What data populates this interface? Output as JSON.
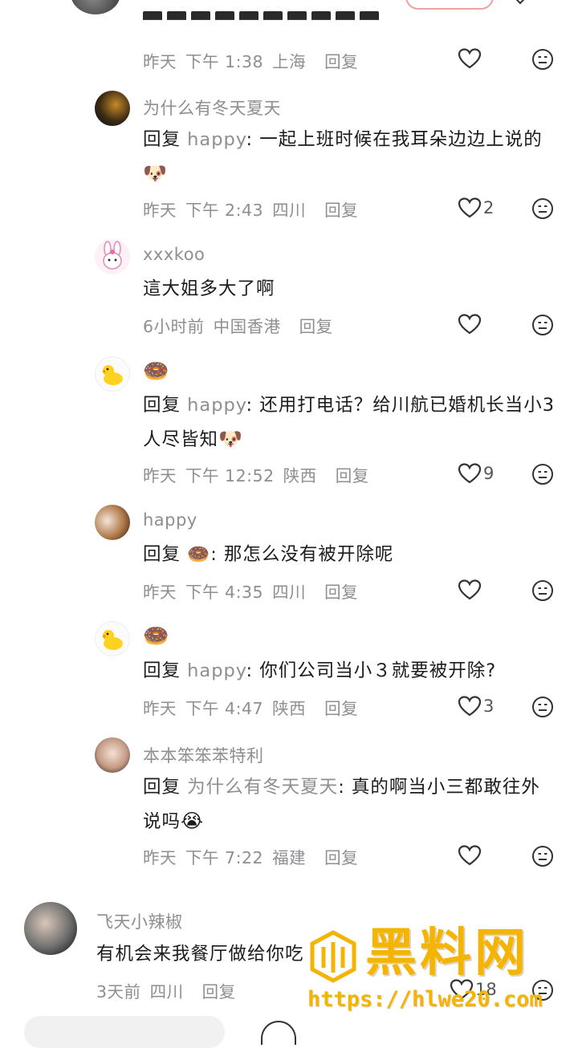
{
  "comments": [
    {
      "id": "c0",
      "meta": {
        "day": "昨天",
        "time": "下午 1:38",
        "location": "上海",
        "reply": "回复"
      },
      "likes": ""
    },
    {
      "id": "c1",
      "username": "为什么有冬天夏天",
      "reply_prefix": "回复",
      "mention": "happy",
      "text": ": 一起上班时候在我耳朵边边上说的",
      "emoji": "🐶",
      "meta": {
        "day": "昨天",
        "time": "下午 2:43",
        "location": "四川",
        "reply": "回复"
      },
      "likes": "2"
    },
    {
      "id": "c2",
      "username": "xxxkoo",
      "text": "這大姐多大了啊",
      "meta": {
        "day": "6小时前",
        "time": "",
        "location": "中国香港",
        "reply": "回复"
      },
      "likes": ""
    },
    {
      "id": "c3",
      "username": "🍩",
      "reply_prefix": "回复",
      "mention": "happy",
      "text": ": 还用打电话？给川航已婚机长当小3人尽皆知",
      "emoji": "🐶",
      "meta": {
        "day": "昨天",
        "time": "下午 12:52",
        "location": "陕西",
        "reply": "回复"
      },
      "likes": "9"
    },
    {
      "id": "c4",
      "username": "happy",
      "reply_prefix": "回复",
      "mention": "🍩",
      "text": ": 那怎么没有被开除呢",
      "meta": {
        "day": "昨天",
        "time": "下午 4:35",
        "location": "四川",
        "reply": "回复"
      },
      "likes": ""
    },
    {
      "id": "c5",
      "username": "🍩",
      "reply_prefix": "回复",
      "mention": "happy",
      "text": ": 你们公司当小３就要被开除?",
      "meta": {
        "day": "昨天",
        "time": "下午 4:47",
        "location": "陕西",
        "reply": "回复"
      },
      "likes": "3"
    },
    {
      "id": "c6",
      "username": "本本笨笨苯特利",
      "reply_prefix": "回复",
      "mention": "为什么有冬天夏天",
      "text": ": 真的啊当小三都敢往外说吗",
      "emoji": "😭",
      "meta": {
        "day": "昨天",
        "time": "下午 7:22",
        "location": "福建",
        "reply": "回复"
      },
      "likes": ""
    },
    {
      "id": "c7",
      "username": "飞天小辣椒",
      "text": "有机会来我餐厅做给你吃",
      "meta": {
        "day": "3天前",
        "time": "",
        "location": "四川",
        "reply": "回复"
      },
      "likes": "18"
    }
  ],
  "watermark": {
    "title": "黑料网",
    "url": "https://hlwe20.com"
  },
  "colors": {
    "secondary_text": "#8e8e93",
    "watermark": "#f5b400",
    "primary_text": "#1c1c1c"
  }
}
